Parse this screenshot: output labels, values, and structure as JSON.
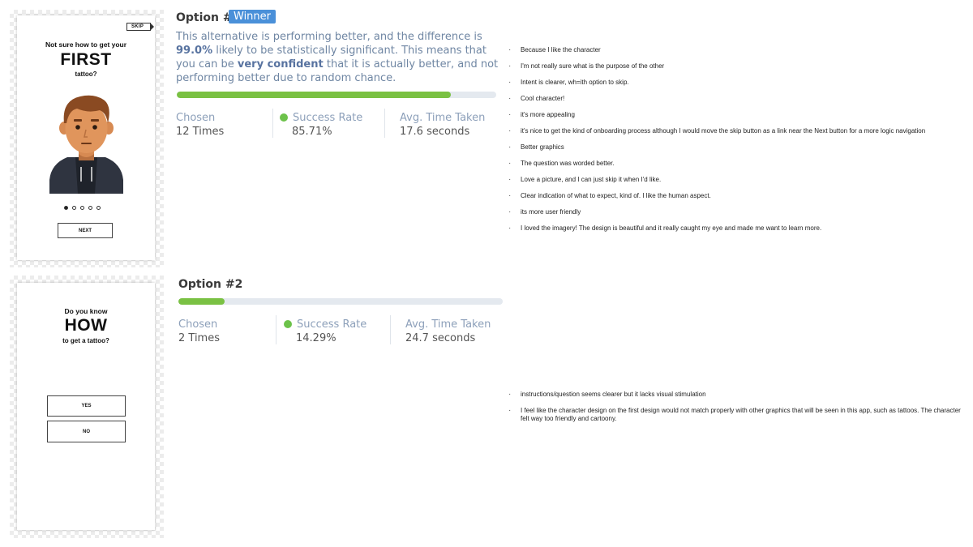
{
  "option1": {
    "mockup": {
      "skip_label": "SKIP",
      "line1": "Not sure how to get your",
      "line2": "FIRST",
      "line3": "tattoo?",
      "next_label": "NEXT",
      "pager": {
        "total": 5,
        "active": 1
      }
    },
    "title": "Option #1",
    "badge": "Winner",
    "description": {
      "part1": "This alternative is performing better, and the difference is ",
      "strong1": "99.0%",
      "part2": " likely to be statistically significant. This means that you can be ",
      "strong2": "very confident",
      "part3": " that it is actually better, and not performing better due to random chance."
    },
    "progress": 0.8571,
    "stats": {
      "chosen_label": "Chosen",
      "chosen_value": "12 Times",
      "success_label": "Success Rate",
      "success_value": "85.71%",
      "time_label": "Avg. Time Taken",
      "time_value": "17.6 seconds"
    },
    "comments": [
      "Because I like the character",
      "I'm not really sure what is the purpose of the other",
      "Intent is clearer, wh=ith option to skip.",
      "Cool character!",
      "it's more appealing",
      "it's nice to get the kind of onboarding process although I would move the skip button as a link near the Next button for a more logic navigation",
      "Better graphics",
      "The question was worded better.",
      "Love a picture, and I can just skip it when I'd like.",
      "Clear indication of what to expect, kind of. I like the human aspect.",
      "its more user friendly",
      "I loved the imagery! The design is beautiful and it really caught my eye and made me want to learn more."
    ]
  },
  "option2": {
    "mockup": {
      "line1": "Do you know",
      "line2": "HOW",
      "line3": "to get a tattoo?",
      "yes_label": "YES",
      "no_label": "NO"
    },
    "title": "Option #2",
    "progress": 0.1429,
    "stats": {
      "chosen_label": "Chosen",
      "chosen_value": "2 Times",
      "success_label": "Success Rate",
      "success_value": "14.29%",
      "time_label": "Avg. Time Taken",
      "time_value": "24.7 seconds"
    },
    "comments": [
      "instructions/question seems clearer but it lacks visual stimulation",
      "I feel like the character design on the first design would not match properly with other graphics that will be seen in this app, such as tattoos. The character felt way too friendly and cartoony."
    ]
  },
  "colors": {
    "badge": "#4a90d9",
    "bar_fill": "#7ac143",
    "bar_track": "#e4e9ef",
    "success_dot": "#6cc24a",
    "description": "#6f86a3"
  },
  "icons": [
    "avatar-character-illustration",
    "success-dot-icon",
    "skip-arrow-icon"
  ]
}
